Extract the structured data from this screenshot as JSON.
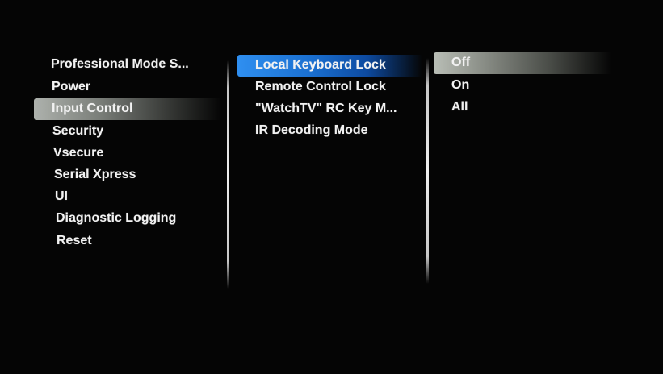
{
  "left_menu": {
    "items": [
      {
        "label": "Professional Mode S..."
      },
      {
        "label": "Power"
      },
      {
        "label": "Input Control"
      },
      {
        "label": "Security"
      },
      {
        "label": "Vsecure"
      },
      {
        "label": "Serial Xpress"
      },
      {
        "label": "UI"
      },
      {
        "label": "Diagnostic Logging"
      },
      {
        "label": "Reset"
      }
    ],
    "selected": "Input Control"
  },
  "middle_menu": {
    "items": [
      {
        "label": "Local Keyboard Lock"
      },
      {
        "label": "Remote Control Lock"
      },
      {
        "label": "\"WatchTV\" RC Key M..."
      },
      {
        "label": "IR Decoding Mode"
      }
    ],
    "focused": "Local Keyboard Lock"
  },
  "options_menu": {
    "items": [
      {
        "label": "Off"
      },
      {
        "label": "On"
      },
      {
        "label": "All"
      }
    ],
    "selected": "Off"
  },
  "colors": {
    "background": "#050505",
    "text": "#f2f2f2",
    "focus_highlight": "#1a6fd0",
    "selection_highlight": "#868a83"
  }
}
